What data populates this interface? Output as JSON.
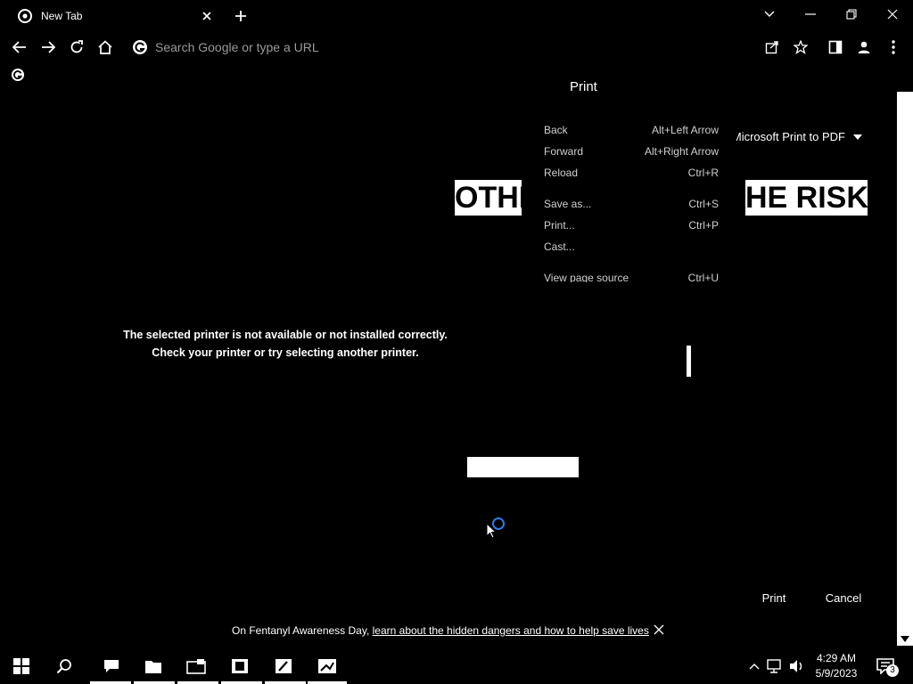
{
  "tab": {
    "title": "New Tab"
  },
  "omnibox": {
    "placeholder": "Search Google or type a URL"
  },
  "print": {
    "title": "Print",
    "destination": "Microsoft Print to PDF",
    "error_line1": "The selected printer is not available or not installed correctly.",
    "error_line2": "Check your printer or try selecting another printer.",
    "print_label": "Print",
    "cancel_label": "Cancel",
    "banner_left": "OTHIN",
    "banner_right": "HE RISK"
  },
  "context_menu": {
    "items": [
      {
        "label": "Back",
        "shortcut": "Alt+Left Arrow"
      },
      {
        "label": "Forward",
        "shortcut": "Alt+Right Arrow"
      },
      {
        "label": "Reload",
        "shortcut": "Ctrl+R"
      },
      {
        "label": "Save as...",
        "shortcut": "Ctrl+S"
      },
      {
        "label": "Print...",
        "shortcut": "Ctrl+P"
      },
      {
        "label": "Cast...",
        "shortcut": ""
      },
      {
        "label": "View page source",
        "shortcut": "Ctrl+U"
      }
    ]
  },
  "notice": {
    "text": "On Fentanyl Awareness Day, ",
    "link": "learn about the hidden dangers and how to help save lives"
  },
  "taskbar": {
    "time": "4:29 AM",
    "date": "5/9/2023",
    "notification_count": "3"
  },
  "colors": {
    "background": "#000000",
    "foreground": "#ffffff",
    "spinner": "#2e7be6"
  }
}
